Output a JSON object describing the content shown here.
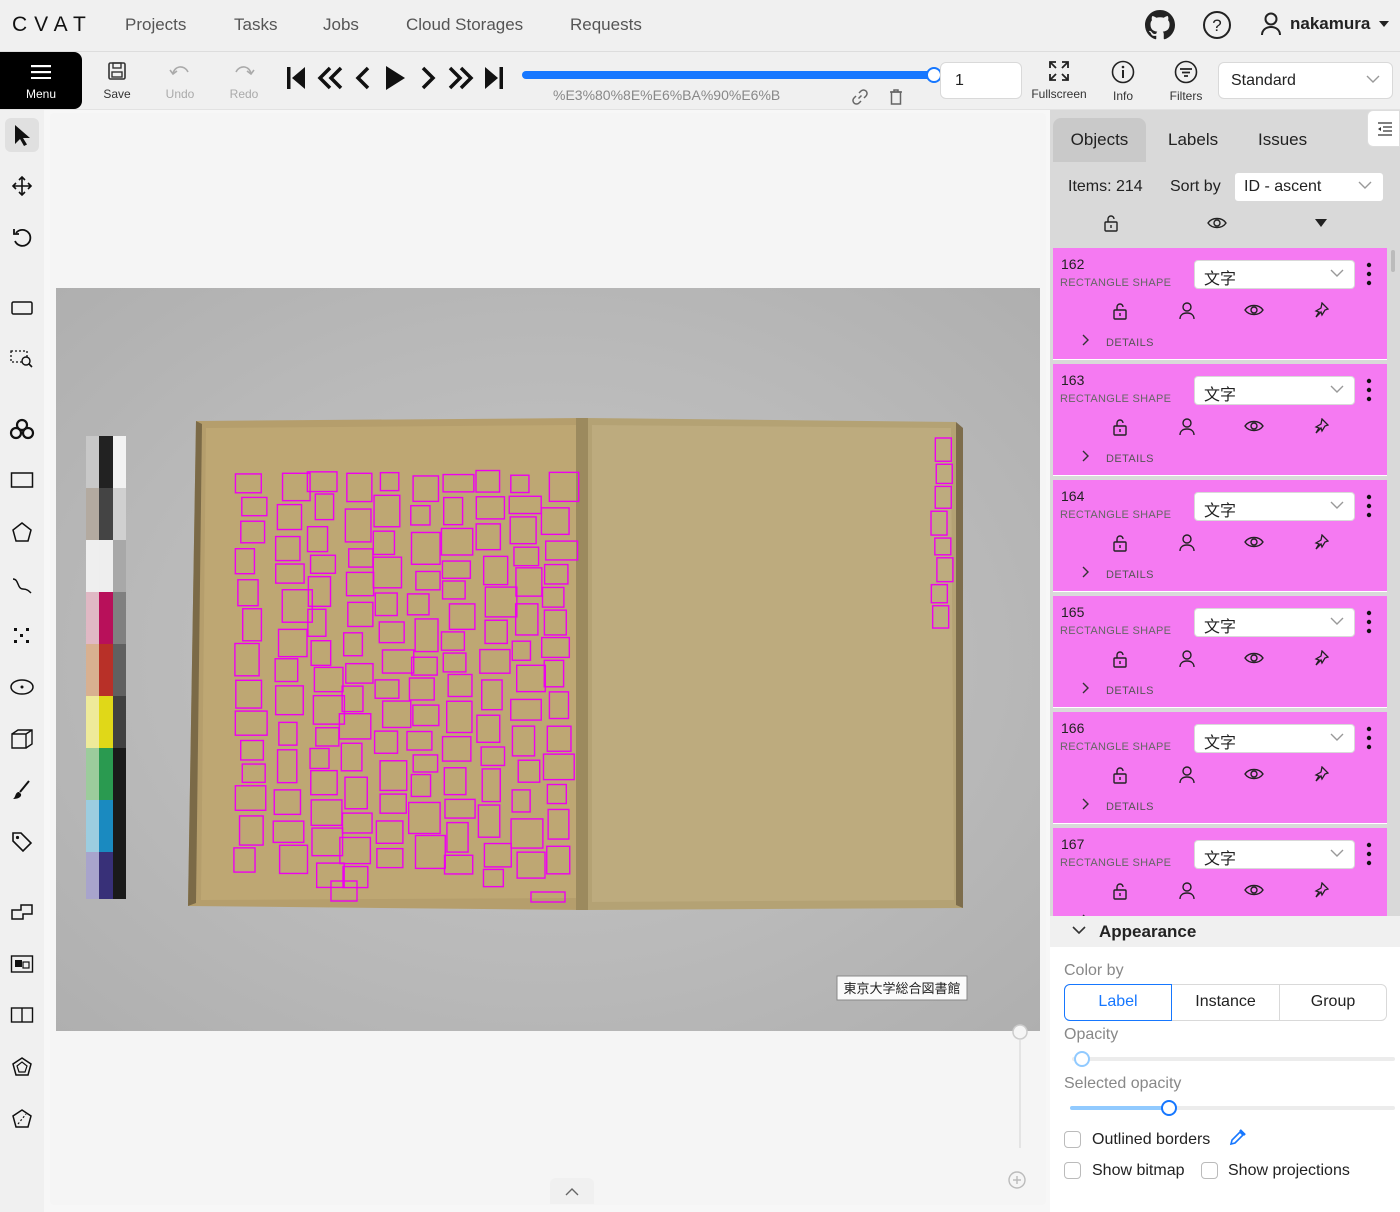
{
  "header": {
    "logo": "CVAT",
    "nav": [
      "Projects",
      "Tasks",
      "Jobs",
      "Cloud Storages",
      "Requests"
    ],
    "username": "nakamura"
  },
  "toolbar": {
    "menu_label": "Menu",
    "save_label": "Save",
    "undo_label": "Undo",
    "redo_label": "Redo",
    "filename": "%E3%80%8E%E6%BA%90%E6%B",
    "frame_number": "1",
    "frame_progress": 1.0,
    "fullscreen_label": "Fullscreen",
    "info_label": "Info",
    "filters_label": "Filters",
    "workspace": "Standard"
  },
  "canvas": {
    "library_stamp": "東京大学総合図書館"
  },
  "sidebar": {
    "tabs": [
      "Objects",
      "Labels",
      "Issues"
    ],
    "active_tab": "Objects",
    "items_text": "Items: 214",
    "sort_label": "Sort by",
    "sort_value": "ID - ascent",
    "objects": [
      {
        "id": "162",
        "type": "RECTANGLE SHAPE",
        "label": "文字",
        "details": "DETAILS"
      },
      {
        "id": "163",
        "type": "RECTANGLE SHAPE",
        "label": "文字",
        "details": "DETAILS"
      },
      {
        "id": "164",
        "type": "RECTANGLE SHAPE",
        "label": "文字",
        "details": "DETAILS"
      },
      {
        "id": "165",
        "type": "RECTANGLE SHAPE",
        "label": "文字",
        "details": "DETAILS"
      },
      {
        "id": "166",
        "type": "RECTANGLE SHAPE",
        "label": "文字",
        "details": "DETAILS"
      },
      {
        "id": "167",
        "type": "RECTANGLE SHAPE",
        "label": "文字",
        "details": "DETAILS"
      }
    ],
    "object_color": "#f57af2"
  },
  "appearance": {
    "title": "Appearance",
    "color_by_label": "Color by",
    "color_by_options": [
      "Label",
      "Instance",
      "Group"
    ],
    "color_by_selected": "Label",
    "opacity_label": "Opacity",
    "opacity_value": 0.03,
    "selected_opacity_label": "Selected opacity",
    "selected_opacity_value": 0.3,
    "outlined_borders_label": "Outlined borders",
    "show_bitmap_label": "Show bitmap",
    "show_projections_label": "Show projections"
  }
}
